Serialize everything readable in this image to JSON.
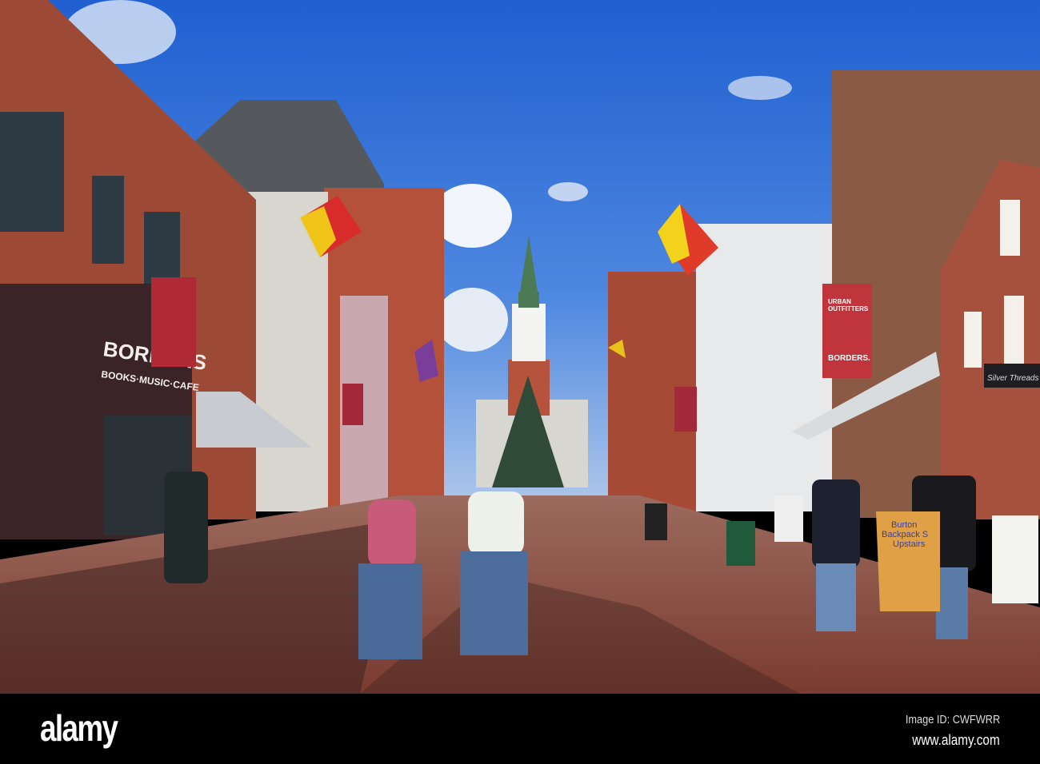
{
  "photo": {
    "description_signs": {
      "borders_store": "BORDERS",
      "borders_sub": "BOOKS·MUSIC·CAFE",
      "banner_line1": "URBAN",
      "banner_line2": "OUTFITTERS",
      "banner_borders": "BORDERS.",
      "burton_line1": "Burton",
      "burton_line2": "Backpack S",
      "burton_line3": "Upstairs",
      "silver_threads": "Silver Threads Tailoring"
    },
    "watermark": "alamy"
  },
  "footer": {
    "logo": "alamy",
    "image_id": "Image ID: CWFWRR",
    "url": "www.alamy.com"
  }
}
